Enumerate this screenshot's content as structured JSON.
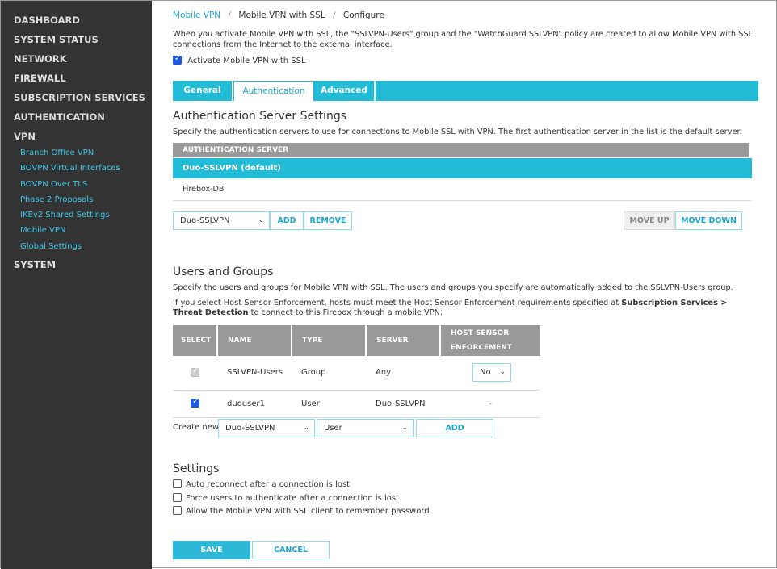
{
  "sidebar": {
    "items": [
      "DASHBOARD",
      "SYSTEM STATUS",
      "NETWORK",
      "FIREWALL",
      "SUBSCRIPTION SERVICES",
      "AUTHENTICATION",
      "VPN"
    ],
    "vpn_sub": [
      "Branch Office VPN",
      "BOVPN Virtual Interfaces",
      "BOVPN Over TLS",
      "Phase 2 Proposals",
      "IKEv2 Shared Settings",
      "Mobile VPN",
      "Global Settings"
    ],
    "last": "SYSTEM"
  },
  "breadcrumb": [
    "Mobile VPN",
    "Mobile VPN with SSL",
    "Configure"
  ],
  "sep": "/",
  "intro": "When you activate Mobile VPN with SSL, the \"SSLVPN-Users\" group and the \"WatchGuard SSLVPN\" policy are created to allow Mobile VPN with SSL connections from the Internet to the external interface.",
  "activate_label": "Activate Mobile VPN with SSL",
  "tabs": [
    "General",
    "Authentication",
    "Advanced"
  ],
  "auth": {
    "title": "Authentication Server Settings",
    "desc": "Specify the authentication servers to use for connections to Mobile SSL with VPN. The first authentication server in the list is the default server.",
    "header": "AUTHENTICATION SERVER",
    "rows": [
      "Duo-SSLVPN (default)",
      "Firebox-DB"
    ],
    "select": "Duo-SSLVPN",
    "add": "ADD",
    "remove": "REMOVE",
    "move_up": "MOVE UP",
    "move_down": "MOVE DOWN"
  },
  "users": {
    "title": "Users and Groups",
    "desc": "Specify the users and groups for Mobile VPN with SSL. The users and groups you specify are automatically added to the SSLVPN-Users group.",
    "note_pre": "If you select Host Sensor Enforcement, hosts must meet the Host Sensor Enforcement requirements specified at ",
    "note_bold": "Subscription Services > Threat Detection",
    "note_post": " to connect to this Firebox through a mobile VPN.",
    "headers": [
      "SELECT",
      "NAME",
      "TYPE",
      "SERVER",
      "HOST SENSOR ENFORCEMENT"
    ],
    "rows": [
      {
        "name": "SSLVPN-Users",
        "type": "Group",
        "server": "Any",
        "hse": "No"
      },
      {
        "name": "duouser1",
        "type": "User",
        "server": "Duo-SSLVPN",
        "hse": "-"
      }
    ],
    "create_label": "Create new:",
    "create_server": "Duo-SSLVPN",
    "create_type": "User",
    "add": "ADD"
  },
  "settings": {
    "title": "Settings",
    "options": [
      "Auto reconnect after a connection is lost",
      "Force users to authenticate after a connection is lost",
      "Allow the Mobile VPN with SSL client to remember password"
    ]
  },
  "save": "SAVE",
  "cancel": "CANCEL"
}
